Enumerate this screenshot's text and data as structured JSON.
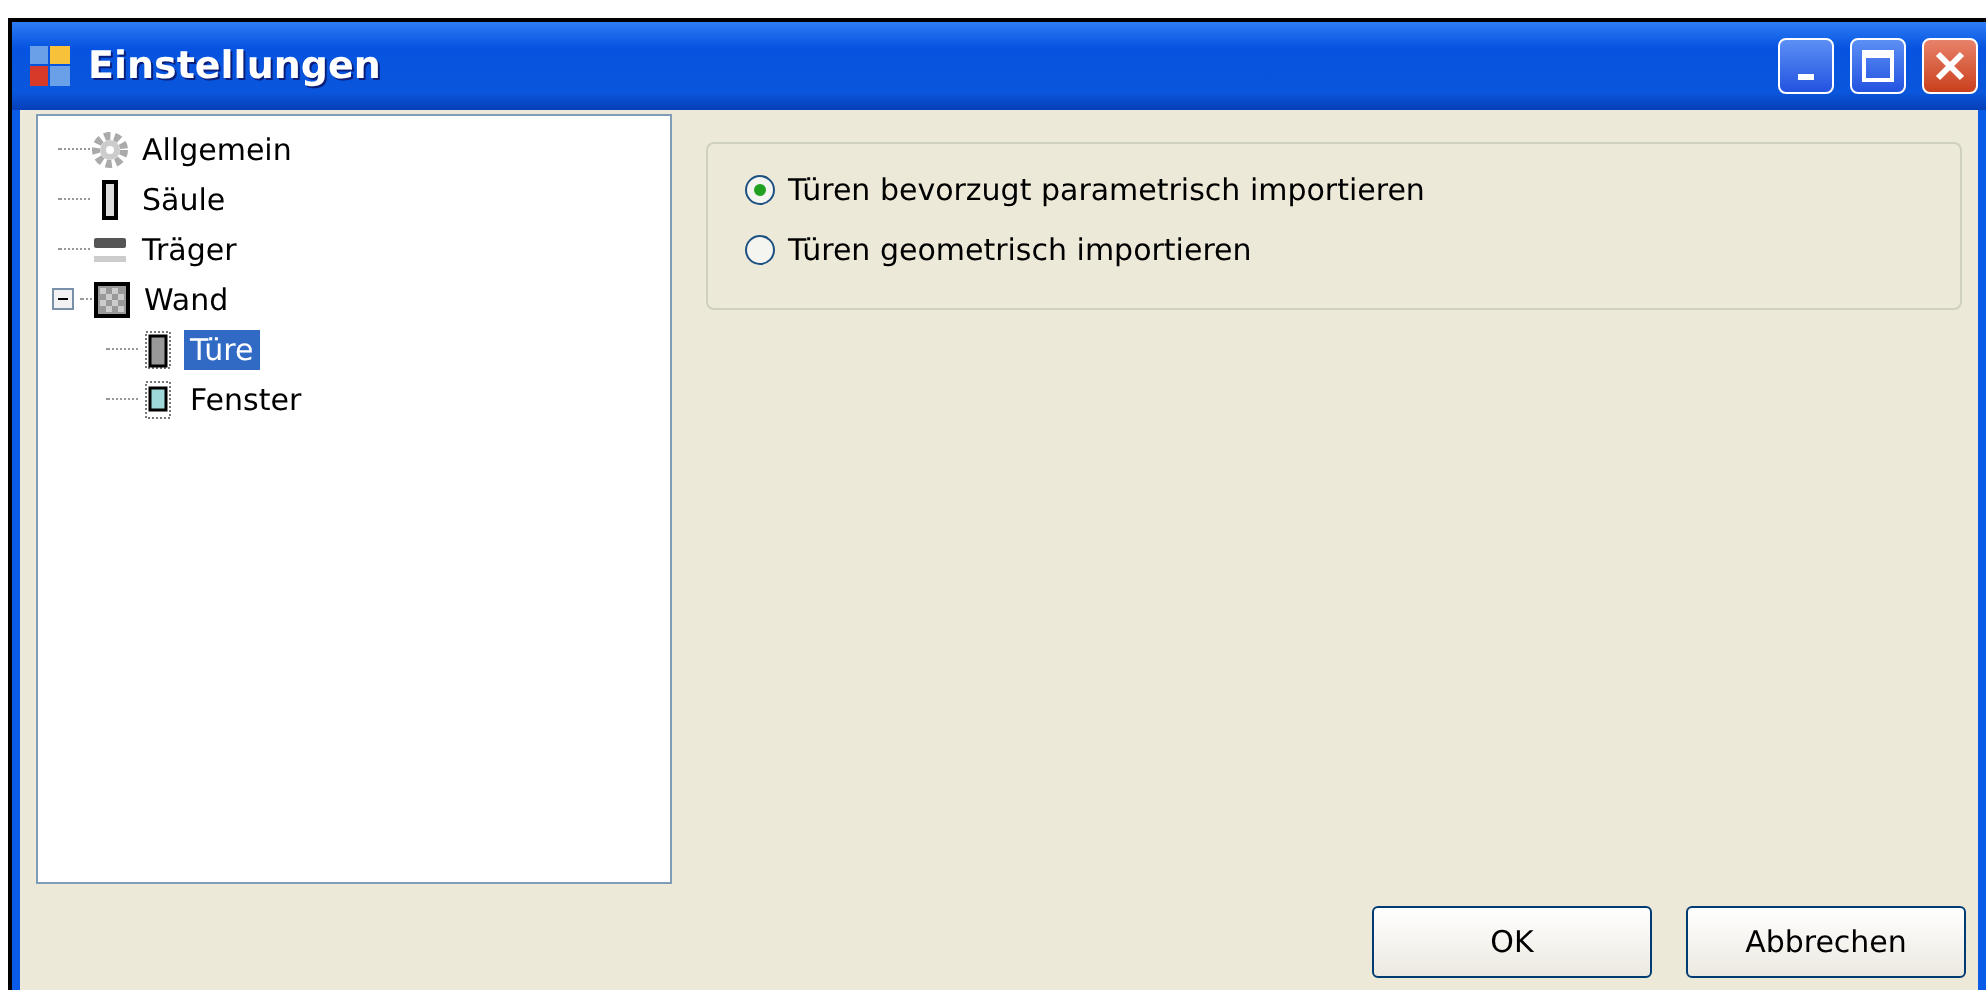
{
  "window": {
    "title": "Einstellungen"
  },
  "tree": [
    {
      "kind": "gear",
      "label": "Allgemein",
      "selected": false
    },
    {
      "kind": "column",
      "label": "Säule",
      "selected": false
    },
    {
      "kind": "beam",
      "label": "Träger",
      "selected": false
    },
    {
      "kind": "wall",
      "label": "Wand",
      "selected": false,
      "expanded": true,
      "children": [
        {
          "kind": "door",
          "label": "Türe",
          "selected": true
        },
        {
          "kind": "window",
          "label": "Fenster",
          "selected": false
        }
      ]
    }
  ],
  "options": [
    {
      "label": "Türen bevorzugt parametrisch importieren",
      "selected": true
    },
    {
      "label": "Türen geometrisch importieren",
      "selected": false
    }
  ],
  "buttons": [
    "OK",
    "Abbrechen"
  ]
}
